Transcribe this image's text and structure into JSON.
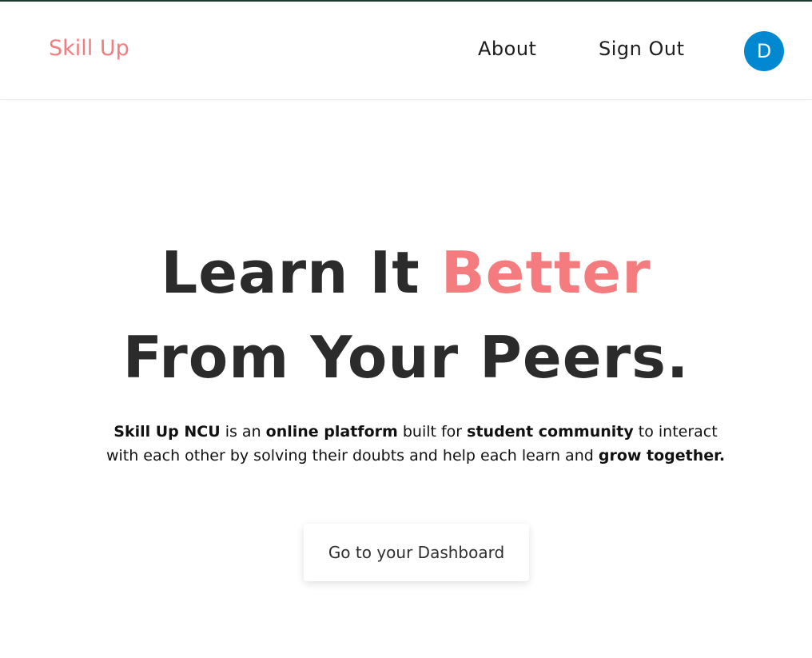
{
  "navbar": {
    "brand": "Skill Up",
    "links": [
      {
        "label": "About"
      },
      {
        "label": "Sign Out"
      }
    ],
    "avatar_initial": "D",
    "avatar_color": "#0288d1"
  },
  "hero": {
    "title_line1_plain": "Learn It ",
    "title_line1_accent": "Better",
    "title_line2": "From Your Peers.",
    "description": {
      "part1_bold": "Skill Up NCU",
      "part2": " is an ",
      "part3_bold": "online platform",
      "part4": " built for ",
      "part5_bold": "student community",
      "part6": " to interact with each other by solving their doubts and help each learn and ",
      "part7_bold": "grow together."
    },
    "cta_label": "Go to your Dashboard"
  },
  "colors": {
    "accent": "#f47c7f",
    "heading": "#2b2b2b",
    "top_border": "#1f3b34"
  }
}
